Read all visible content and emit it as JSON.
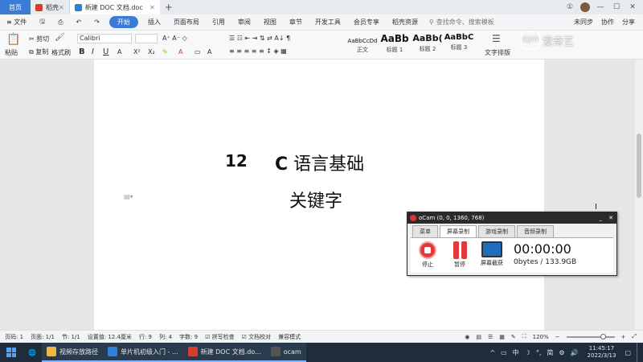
{
  "tabs": {
    "home": "首页",
    "daoke": "稻壳",
    "doc": "新建 DOC 文档.doc"
  },
  "menu": {
    "file": "文件",
    "items": [
      "开始",
      "插入",
      "页面布局",
      "引用",
      "审阅",
      "视图",
      "章节",
      "开发工具",
      "会员专享",
      "稻壳资源"
    ],
    "search": "查找命令、搜索模板",
    "right": [
      "未同步",
      "协作",
      "分享"
    ]
  },
  "ribbon": {
    "paste": "粘贴",
    "cut": "剪切",
    "copy": "复制",
    "format_painter": "格式刷",
    "font": "Calibri",
    "styles": [
      {
        "preview": "AaBbCcDd",
        "name": "正文"
      },
      {
        "preview": "AaBb",
        "name": "标题 1"
      },
      {
        "preview": "AaBb(",
        "name": "标题 2"
      },
      {
        "preview": "AaBbC",
        "name": "标题 3"
      }
    ],
    "text_layout": "文字排版"
  },
  "document": {
    "number": "12",
    "title_latin": "C",
    "title_cjk": "语言基础",
    "subtitle": "关键字"
  },
  "ocam": {
    "title": "oCam (0, 0, 1360, 768)",
    "tabs": [
      "菜单",
      "屏幕录制",
      "游戏录制",
      "音频录制"
    ],
    "stop": "停止",
    "pause": "暂停",
    "capture": "屏幕截获",
    "time": "00:00:00",
    "size": "0bytes / 133.9GB"
  },
  "watermark": {
    "logo": "iQIYI",
    "text": "爱奇艺"
  },
  "status": {
    "page": "页码: 1",
    "pages": "页面: 1/1",
    "section": "节: 1/1",
    "setting": "设置值: 12.4厘米",
    "row": "行: 9",
    "col": "列: 4",
    "words": "字数: 9",
    "spell": "拼写检查",
    "doc_check": "文档校对",
    "compat": "兼容模式",
    "zoom": "120%"
  },
  "taskbar": {
    "apps": [
      {
        "label": "视频存放路径",
        "color": "#e8b84a"
      },
      {
        "label": "单片机初级入门 - ...",
        "color": "#2f7fd6"
      },
      {
        "label": "新建 DOC 文档.do...",
        "color": "#d83b2f"
      },
      {
        "label": "ocam",
        "color": "#555555"
      }
    ],
    "ime": "中",
    "ime2": "简",
    "time": "11:45:17",
    "date": "2022/3/13"
  },
  "colors": {
    "accent": "#3a7bd5",
    "record_red": "#e03a3a",
    "taskbar_bg": "#1e2c3c"
  }
}
